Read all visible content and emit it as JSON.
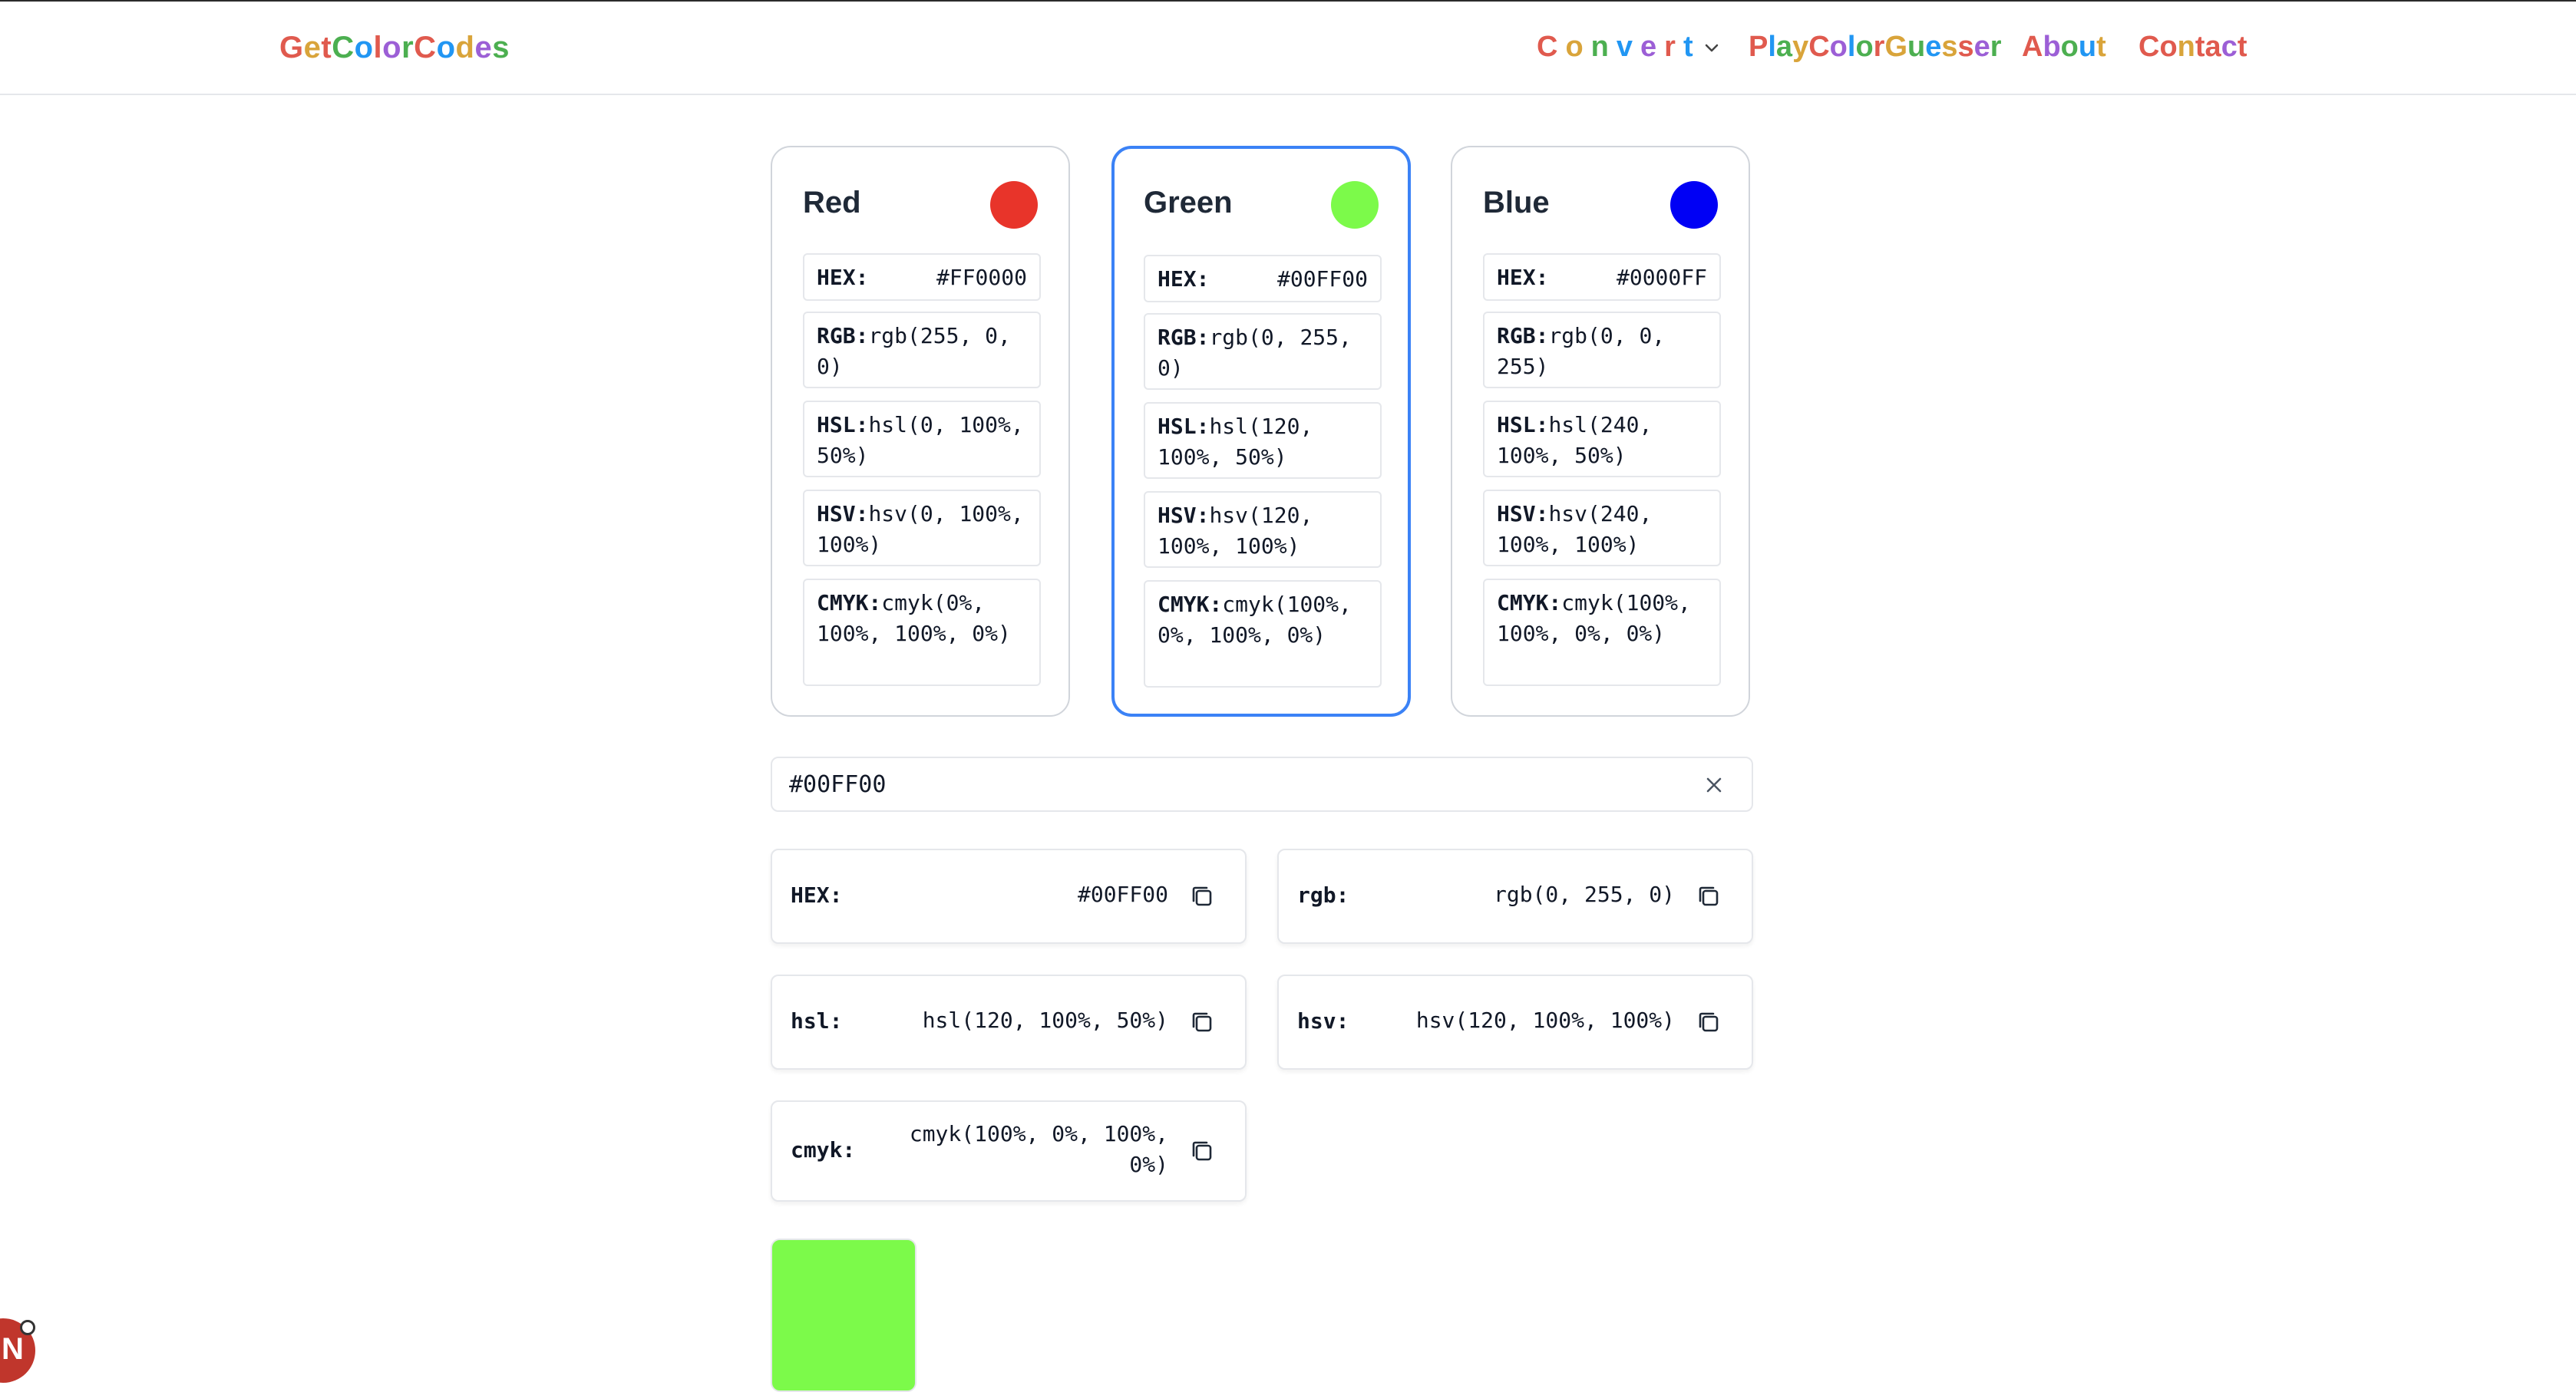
{
  "nav": {
    "logo": [
      "G",
      "e",
      "t",
      "C",
      "o",
      "l",
      "o",
      "r",
      "C",
      "o",
      "d",
      "e",
      "s"
    ],
    "logo_colors": [
      "#e05a4e",
      "#d9a43a",
      "#e05a4e",
      "#4caf50",
      "#2196f3",
      "#e05a4e",
      "#9c5fd6",
      "#4caf50",
      "#e05a4e",
      "#2196f3",
      "#d9a43a",
      "#9c5fd6",
      "#4caf50"
    ],
    "convert": [
      "C",
      "o",
      "n",
      "v",
      "e",
      "r",
      "t"
    ],
    "convert_colors": [
      "#e05a4e",
      "#d9a43a",
      "#4caf50",
      "#2196f3",
      "#9c5fd6",
      "#e05a4e",
      "#2196f3"
    ],
    "guesser": [
      "P",
      "l",
      "a",
      "y",
      "C",
      "o",
      "l",
      "o",
      "r",
      "G",
      "u",
      "e",
      "s",
      "s",
      "e",
      "r"
    ],
    "guesser_colors": [
      "#e05a4e",
      "#2196f3",
      "#4caf50",
      "#d9a43a",
      "#e05a4e",
      "#9c5fd6",
      "#2196f3",
      "#4caf50",
      "#e05a4e",
      "#d9a43a",
      "#4caf50",
      "#2196f3",
      "#d9a43a",
      "#e05a4e",
      "#9c5fd6",
      "#4caf50"
    ],
    "about": [
      "A",
      "b",
      "o",
      "u",
      "t"
    ],
    "about_colors": [
      "#e05a4e",
      "#9c5fd6",
      "#4caf50",
      "#2196f3",
      "#d9a43a"
    ],
    "contact": [
      "C",
      "o",
      "n",
      "t",
      "a",
      "c",
      "t"
    ],
    "contact_colors": [
      "#e05a4e",
      "#e05a4e",
      "#d9a43a",
      "#e05a4e",
      "#e05a4e",
      "#9c5fd6",
      "#e05a4e"
    ]
  },
  "cards": {
    "red": {
      "title": "Red",
      "color": "#e8342a",
      "hex_label": "HEX:",
      "hex": "#FF0000",
      "rgb_label": "RGB:",
      "rgb": "rgb(255, 0, 0)",
      "hsl_label": "HSL:",
      "hsl": "hsl(0, 100%, 50%)",
      "hsv_label": "HSV:",
      "hsv": "hsv(0, 100%, 100%)",
      "cmyk_label": "CMYK:",
      "cmyk": "cmyk(0%, 100%, 100%, 0%)"
    },
    "green": {
      "title": "Green",
      "color": "#7cfa4a",
      "hex_label": "HEX:",
      "hex": "#00FF00",
      "rgb_label": "RGB:",
      "rgb": "rgb(0, 255, 0)",
      "hsl_label": "HSL:",
      "hsl": "hsl(120, 100%, 50%)",
      "hsv_label": "HSV:",
      "hsv": "hsv(120, 100%, 100%)",
      "cmyk_label": "CMYK:",
      "cmyk": "cmyk(100%, 0%, 100%, 0%)"
    },
    "blue": {
      "title": "Blue",
      "color": "#0000f5",
      "hex_label": "HEX:",
      "hex": "#0000FF",
      "rgb_label": "RGB:",
      "rgb": "rgb(0, 0, 255)",
      "hsl_label": "HSL:",
      "hsl": "hsl(240, 100%, 50%)",
      "hsv_label": "HSV:",
      "hsv": "hsv(240, 100%, 100%)",
      "cmyk_label": "CMYK:",
      "cmyk": "cmyk(100%, 100%, 0%, 0%)"
    }
  },
  "input": {
    "value": "#00FF00"
  },
  "outputs": {
    "hex_label": "HEX:",
    "hex": "#00FF00",
    "rgb_label": "rgb:",
    "rgb": "rgb(0, 255, 0)",
    "hsl_label": "hsl:",
    "hsl": "hsl(120, 100%, 50%)",
    "hsv_label": "hsv:",
    "hsv": "hsv(120, 100%, 100%)",
    "cmyk_label": "cmyk:",
    "cmyk_line1": "cmyk(100%, 0%, 100%,",
    "cmyk_line2": "0%)"
  },
  "preview": {
    "color": "#7cfa4a"
  },
  "badge": {
    "letter": "N"
  }
}
